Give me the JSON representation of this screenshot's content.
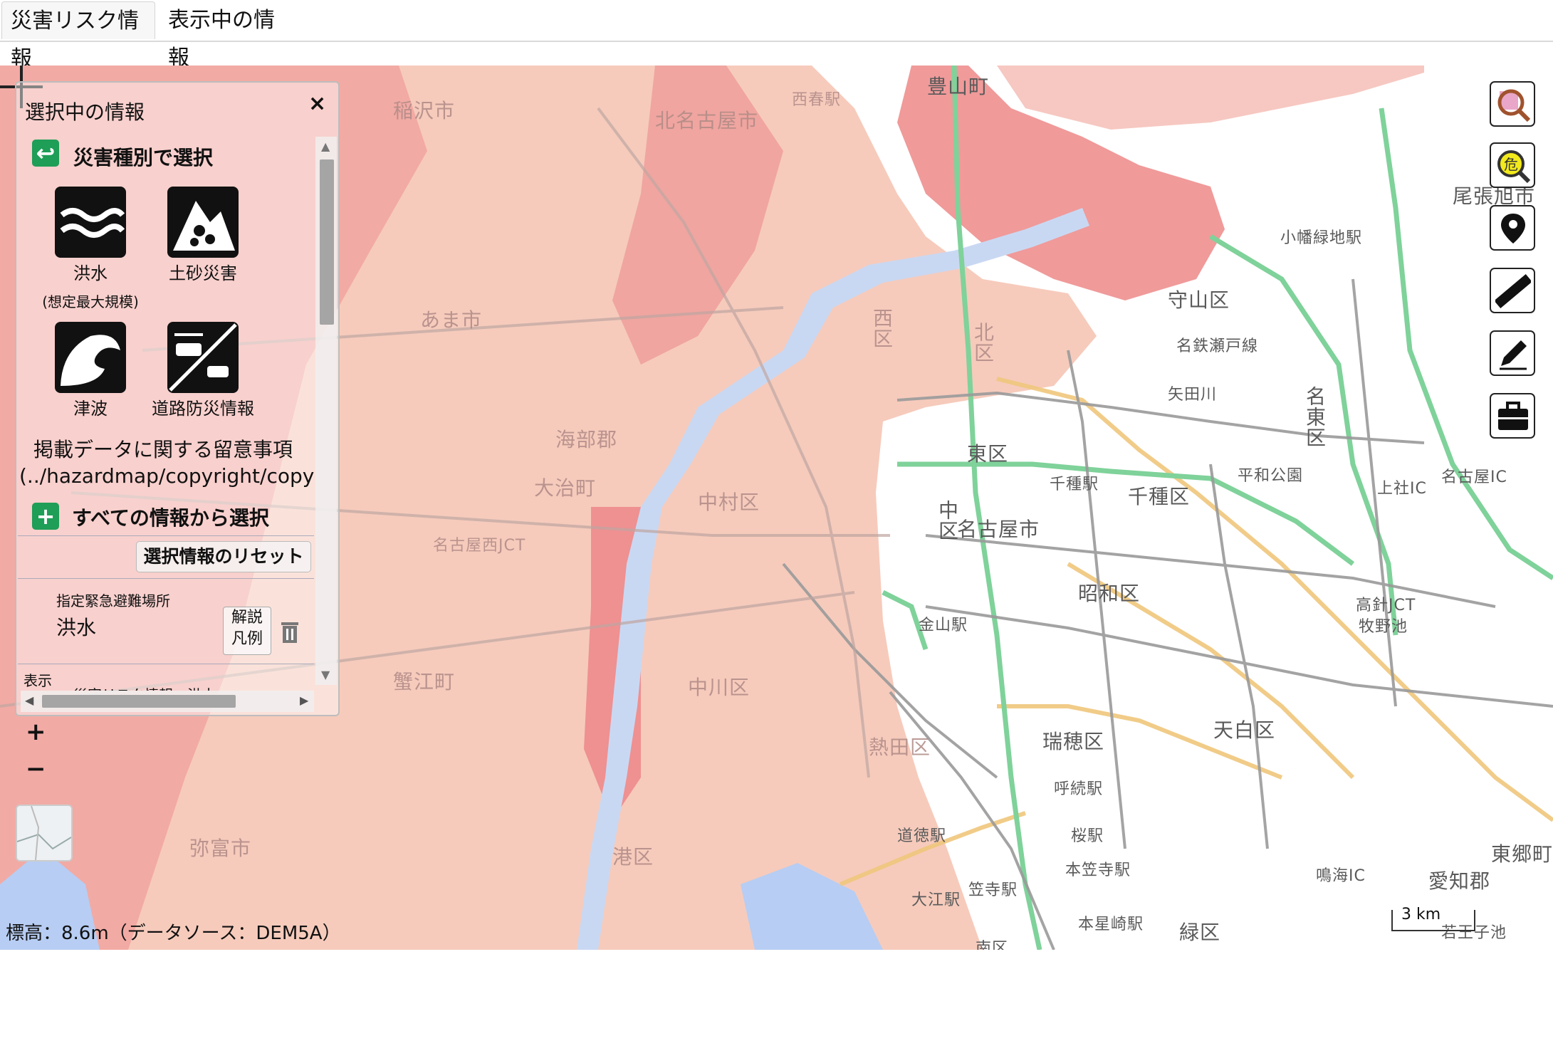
{
  "tabs": [
    "災害リスク情報",
    "表示中の情報"
  ],
  "panel": {
    "title": "選択中の情報",
    "close": "×",
    "section_hazard": "災害種別で選択",
    "hazards": [
      {
        "icon": "flood-icon",
        "label": "洪水",
        "sub": "(想定最大規模)"
      },
      {
        "icon": "landslide-icon",
        "label": "土砂災害",
        "sub": ""
      },
      {
        "icon": "tsunami-icon",
        "label": "津波",
        "sub": ""
      },
      {
        "icon": "road-disaster-icon",
        "label": "道路防災情報",
        "sub": ""
      }
    ],
    "note_line1": "掲載データに関する留意事項",
    "note_line2": "(../hazardmap/copyright/copy",
    "section_all": "すべての情報から選択",
    "reset": "選択情報のリセット",
    "layer_category": "指定緊急避難場所",
    "layer_name": "洪水",
    "legend_btn_line1": "解説",
    "legend_btn_line2": "凡例",
    "display_label": "表示",
    "display_partial": "災害リスク情報：洪水"
  },
  "zoom": {
    "in": "+",
    "out": "−"
  },
  "scale_label": "3 km",
  "elevation": "標高：8.6m（データソース：DEM5A）",
  "map_labels": {
    "inazawa": "稲沢市",
    "kitanagoya": "北名古屋市",
    "toyoyama": "豊山町",
    "nishiharu": "西春駅",
    "amashi": "あま市",
    "kaifu": "海部郡",
    "oharu": "大治町",
    "nakamura": "中村区",
    "nishi": "西区",
    "kita": "北区",
    "higashi": "東区",
    "naka": "中区",
    "nagoya": "名古屋市",
    "chikusa": "千種区",
    "meito": "名東区",
    "showa": "昭和区",
    "mizuho": "瑞穂区",
    "tenpaku": "天白区",
    "nakagawa": "中川区",
    "atsuta": "熱田区",
    "minato": "港区",
    "kanie": "蟹江町",
    "yatomi": "弥富市",
    "midori": "緑区",
    "owariasahi": "尾張旭市",
    "moriyama": "守山区",
    "aichi": "愛知郡",
    "togo": "東郷町",
    "chikusa_st": "千種駅",
    "kanayama": "金山駅",
    "heiwa": "平和公園",
    "yadagawa": "矢田川",
    "meitetsu_seto": "名鉄瀬戸線",
    "komaki_st": "小幡緑地駅",
    "kasadera": "笠寺駅",
    "ooe": "大江駅",
    "dotoku": "道徳駅",
    "sakura": "桜駅",
    "motokasadera": "本笠寺駅",
    "motohoshizaki": "本星崎駅",
    "yobitsugi": "呼続駅",
    "nanbu": "南区",
    "kozoji": "高針JCT",
    "makino": "牧野池",
    "wakasa": "若王子池",
    "kamiyashiro": "上社IC",
    "narumi": "鳴海IC",
    "meito2": "名古屋IC",
    "nagoyanishi": "名古屋西JCT"
  }
}
